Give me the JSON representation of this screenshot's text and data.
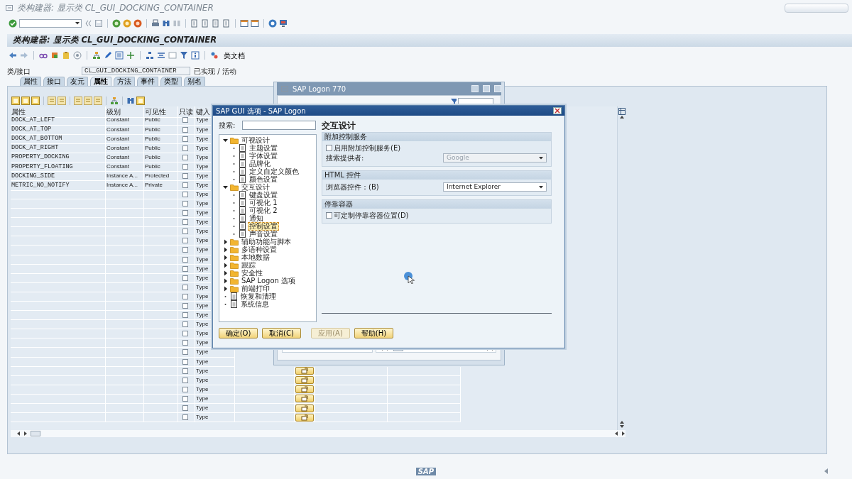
{
  "window": {
    "title": "类构建器: 显示类 CL_GUI_DOCKING_CONTAINER"
  },
  "screen": {
    "title": "类构建器: 显示类 CL_GUI_DOCKING_CONTAINER",
    "toolbar_button": "类文档"
  },
  "class_field": {
    "label": "类/接口",
    "value": "CL_GUI_DOCKING_CONTAINER",
    "status": "已实现 / 活动"
  },
  "tabs": [
    {
      "label": "属性",
      "selected": false
    },
    {
      "label": "接口",
      "selected": false
    },
    {
      "label": "友元",
      "selected": false
    },
    {
      "label": "属性",
      "selected": true
    },
    {
      "label": "方法",
      "selected": false
    },
    {
      "label": "事件",
      "selected": false
    },
    {
      "label": "类型",
      "selected": false
    },
    {
      "label": "别名",
      "selected": false
    }
  ],
  "table": {
    "columns": [
      "属性",
      "级别",
      "可见性",
      "只读",
      "键入"
    ],
    "rows": [
      {
        "name": "DOCK_AT_LEFT",
        "level": "Constant",
        "visibility": "Public",
        "read_only": false,
        "typing": "Type"
      },
      {
        "name": "DOCK_AT_TOP",
        "level": "Constant",
        "visibility": "Public",
        "read_only": false,
        "typing": "Type"
      },
      {
        "name": "DOCK_AT_BOTTOM",
        "level": "Constant",
        "visibility": "Public",
        "read_only": false,
        "typing": "Type"
      },
      {
        "name": "DOCK_AT_RIGHT",
        "level": "Constant",
        "visibility": "Public",
        "read_only": false,
        "typing": "Type"
      },
      {
        "name": "PROPERTY_DOCKING",
        "level": "Constant",
        "visibility": "Public",
        "read_only": false,
        "typing": "Type"
      },
      {
        "name": "PROPERTY_FLOATING",
        "level": "Constant",
        "visibility": "Public",
        "read_only": false,
        "typing": "Type"
      },
      {
        "name": "DOCKING_SIDE",
        "level": "Instance A...",
        "visibility": "Protected",
        "read_only": false,
        "typing": "Type"
      },
      {
        "name": "METRIC_NO_NOTIFY",
        "level": "Instance A...",
        "visibility": "Private",
        "read_only": false,
        "typing": "Type"
      },
      {
        "read_only": false,
        "typing": "Type"
      },
      {
        "read_only": false,
        "typing": "Type"
      },
      {
        "read_only": false,
        "typing": "Type"
      },
      {
        "read_only": false,
        "typing": "Type"
      },
      {
        "read_only": false,
        "typing": "Type"
      },
      {
        "read_only": false,
        "typing": "Type"
      },
      {
        "read_only": false,
        "typing": "Type"
      },
      {
        "read_only": false,
        "typing": "Type"
      },
      {
        "read_only": false,
        "typing": "Type"
      },
      {
        "read_only": false,
        "typing": "Type"
      },
      {
        "read_only": false,
        "typing": "Type"
      },
      {
        "read_only": false,
        "typing": "Type"
      },
      {
        "read_only": false,
        "typing": "Type"
      },
      {
        "read_only": false,
        "typing": "Type"
      },
      {
        "read_only": false,
        "typing": "Type"
      },
      {
        "read_only": false,
        "typing": "Type"
      },
      {
        "read_only": false,
        "typing": "Type"
      },
      {
        "read_only": false,
        "typing": "Type"
      },
      {
        "read_only": false,
        "typing": "Type"
      },
      {
        "read_only": false,
        "typing": "Type",
        "detail_button": true
      },
      {
        "read_only": false,
        "typing": "Type",
        "detail_button": true
      },
      {
        "read_only": false,
        "typing": "Type",
        "detail_button": true
      },
      {
        "read_only": false,
        "typing": "Type",
        "detail_button": true
      },
      {
        "read_only": false,
        "typing": "Type",
        "detail_button": true
      },
      {
        "read_only": false,
        "typing": "Type",
        "detail_button": true
      }
    ]
  },
  "logon_window": {
    "title": "SAP Logon 770"
  },
  "dialog": {
    "title": "SAP GUI 选项 - SAP Logon",
    "search_label": "搜索:",
    "heading": "交互设计",
    "tree": [
      {
        "label": "可视设计",
        "kind": "folder",
        "expanded": true,
        "selected": false,
        "children": [
          {
            "label": "主题设置",
            "kind": "page",
            "selected": false
          },
          {
            "label": "字体设置",
            "kind": "page",
            "selected": false
          },
          {
            "label": "品牌化",
            "kind": "page",
            "selected": false
          },
          {
            "label": "定义自定义颜色",
            "kind": "page",
            "selected": false
          },
          {
            "label": "颜色设置",
            "kind": "page",
            "selected": false
          }
        ]
      },
      {
        "label": "交互设计",
        "kind": "folder",
        "expanded": true,
        "selected": false,
        "children": [
          {
            "label": "键盘设置",
            "kind": "page",
            "selected": false
          },
          {
            "label": "可视化 1",
            "kind": "page",
            "selected": false
          },
          {
            "label": "可视化 2",
            "kind": "page",
            "selected": false
          },
          {
            "label": "通知",
            "kind": "page",
            "selected": false
          },
          {
            "label": "控制设置",
            "kind": "page",
            "selected": true
          },
          {
            "label": "声音设置",
            "kind": "page",
            "selected": false
          }
        ]
      },
      {
        "label": "辅助功能与脚本",
        "kind": "folder",
        "expanded": false,
        "selected": false
      },
      {
        "label": "多语种设置",
        "kind": "folder",
        "expanded": false,
        "selected": false
      },
      {
        "label": "本地数据",
        "kind": "folder",
        "expanded": false,
        "selected": false
      },
      {
        "label": "跟踪",
        "kind": "folder",
        "expanded": false,
        "selected": false
      },
      {
        "label": "安全性",
        "kind": "folder",
        "expanded": false,
        "selected": false
      },
      {
        "label": "SAP Logon 选项",
        "kind": "folder",
        "expanded": false,
        "selected": false
      },
      {
        "label": "前端打印",
        "kind": "folder",
        "expanded": false,
        "selected": false
      },
      {
        "label": "恢复和清理",
        "kind": "page",
        "selected": false
      },
      {
        "label": "系统信息",
        "kind": "page",
        "selected": false
      }
    ],
    "groups": [
      {
        "title": "附加控制服务",
        "items": [
          {
            "kind": "checkbox",
            "label": "启用附加控制服务(E)",
            "checked": false
          },
          {
            "kind": "dropdown",
            "label": "搜索提供者:",
            "value": "Google",
            "disabled": true
          }
        ]
      },
      {
        "title": "HTML 控件",
        "items": [
          {
            "kind": "dropdown",
            "label": "浏览器控件：(B)",
            "value": "Internet Explorer",
            "disabled": false
          }
        ]
      },
      {
        "title": "停靠容器",
        "items": [
          {
            "kind": "checkbox",
            "label": "可定制停靠容器位置(D)",
            "checked": false
          }
        ]
      }
    ],
    "buttons": [
      {
        "label": "确定(O)",
        "disabled": false
      },
      {
        "label": "取消(C)",
        "disabled": false
      },
      {
        "label": "应用(A)",
        "disabled": true
      },
      {
        "label": "帮助(H)",
        "disabled": false
      }
    ]
  },
  "status_bar": {
    "logo": "SAP"
  }
}
